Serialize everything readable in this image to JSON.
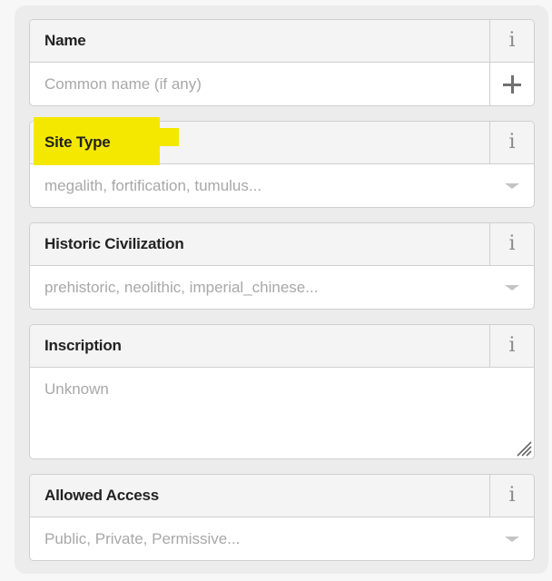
{
  "form": {
    "fields": [
      {
        "label": "Name",
        "type": "text",
        "value": "",
        "placeholder": "Common name (if any)",
        "info_icon": "info-icon",
        "action_icon": "plus-icon"
      },
      {
        "label": "Site Type",
        "type": "combo",
        "value": "",
        "placeholder": "megalith, fortification, tumulus...",
        "info_icon": "info-icon",
        "action_icon": "chevron-down-icon",
        "highlighted": true,
        "highlight_color": "#f5e800"
      },
      {
        "label": "Historic Civilization",
        "type": "combo",
        "value": "",
        "placeholder": "prehistoric, neolithic, imperial_chinese...",
        "info_icon": "info-icon",
        "action_icon": "chevron-down-icon"
      },
      {
        "label": "Inscription",
        "type": "textarea",
        "value": "",
        "placeholder": "Unknown",
        "info_icon": "info-icon",
        "action_icon": "resize-handle-icon"
      },
      {
        "label": "Allowed Access",
        "type": "combo",
        "value": "",
        "placeholder": "Public, Private, Permissive...",
        "info_icon": "info-icon",
        "action_icon": "chevron-down-icon"
      }
    ]
  },
  "icons": {
    "info": "i"
  }
}
